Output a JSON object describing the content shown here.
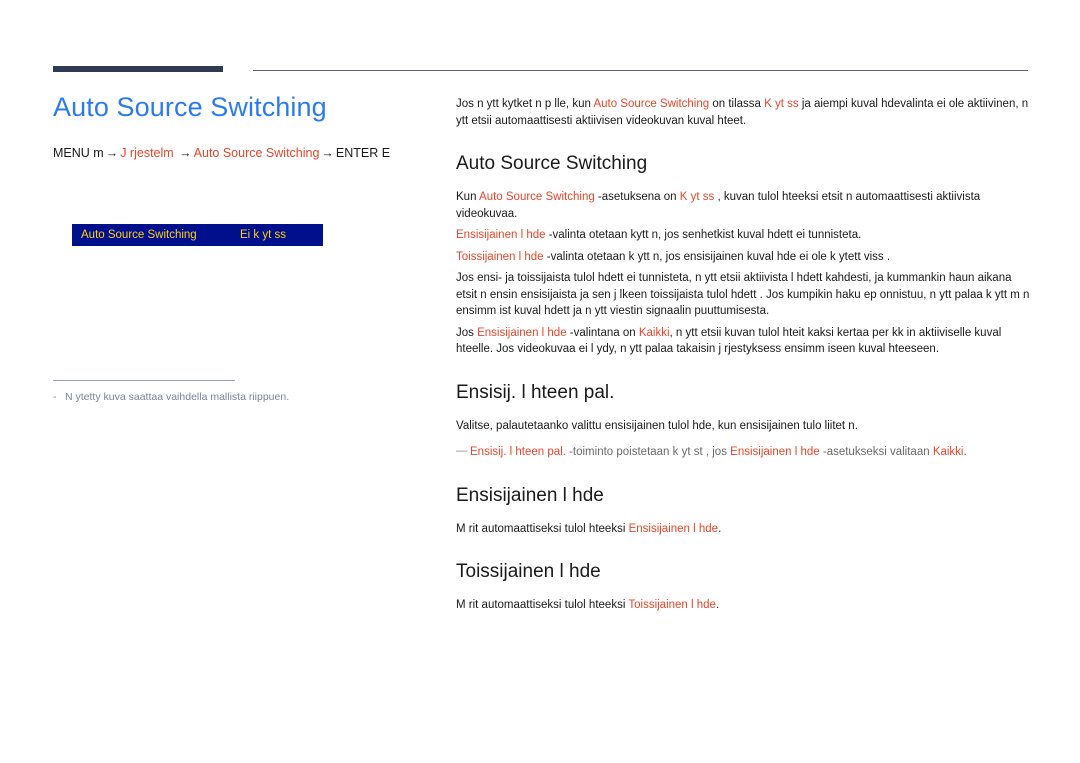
{
  "page": {
    "title": "Auto Source Switching",
    "menu_path": {
      "prefix": "MENU m",
      "arrow": "→",
      "step1": "J rjestelm ",
      "step2": "Auto Source Switching",
      "suffix": "ENTER E"
    }
  },
  "osd": {
    "label": "Auto Source Switching",
    "value": "Ei k yt ss "
  },
  "footnote": {
    "dash": "-",
    "text": "N ytetty kuva saattaa vaihdella mallista riippuen."
  },
  "intro": {
    "t1": "Jos n ytt  kytket  n p  lle, kun ",
    "a1": "Auto Source Switching",
    "t2": " on tilassa ",
    "a2": "K yt ss ",
    "t3": " ja aiempi kuval hdevalinta ei ole aktiivinen, n ytt  etsii automaattisesti aktiivisen videokuvan kuval hteet."
  },
  "sections": [
    {
      "heading": "Auto Source Switching",
      "paragraphs": [
        {
          "runs": [
            {
              "text": "Kun ",
              "style": "plain"
            },
            {
              "text": "Auto Source Switching",
              "style": "accent"
            },
            {
              "text": " -asetuksena on ",
              "style": "plain"
            },
            {
              "text": "K yt ss ",
              "style": "accent"
            },
            {
              "text": ", kuvan tulol hteeksi etsit  n automaattisesti aktiivista videokuvaa.",
              "style": "plain"
            }
          ]
        },
        {
          "runs": [
            {
              "text": "Ensisijainen l hde",
              "style": "accent"
            },
            {
              "text": " -valinta otetaan kytt  n, jos senhetkist  kuval hdett  ei tunnisteta.",
              "style": "plain"
            }
          ]
        },
        {
          "runs": [
            {
              "text": "Toissijainen l hde",
              "style": "accent"
            },
            {
              "text": " -valinta otetaan k ytt  n, jos ensisijainen kuval hde ei ole k ytett viss .",
              "style": "plain"
            }
          ]
        },
        {
          "runs": [
            {
              "text": "Jos ensi- ja toissijaista tulol hdett  ei tunnisteta, n ytt  etsii aktiivista l hdett  kahdesti, ja kummankin haun aikana etsit  n ensin ensisijaista ja sen j lkeen toissijaista tulol hdett . Jos kumpikin haku ep onnistuu, n ytt  palaa k ytt m  n ensimm ist  kuval hdett  ja n ytt  viestin signaalin puuttumisesta.",
              "style": "plain"
            }
          ]
        },
        {
          "runs": [
            {
              "text": "Jos ",
              "style": "plain"
            },
            {
              "text": "Ensisijainen l hde",
              "style": "accent"
            },
            {
              "text": " -valintana on ",
              "style": "plain"
            },
            {
              "text": "Kaikki",
              "style": "accent"
            },
            {
              "text": ", n ytt  etsii kuvan tulol hteit  kaksi kertaa per kk in aktiiviselle kuval hteelle. Jos videokuvaa ei l ydy, n ytt  palaa takaisin j rjestyksess  ensimm iseen kuval hteeseen.",
              "style": "plain"
            }
          ]
        }
      ],
      "note": null
    },
    {
      "heading": "Ensisij. l hteen pal.",
      "paragraphs": [
        {
          "runs": [
            {
              "text": "Valitse, palautetaanko valittu ensisijainen tulol hde, kun ensisijainen tulo liitet  n.",
              "style": "plain"
            }
          ]
        }
      ],
      "note": {
        "mark": "—",
        "runs": [
          {
            "text": "Ensisij. l hteen pal.",
            "style": "accent"
          },
          {
            "text": " -toiminto poistetaan k yt st , jos ",
            "style": "muted"
          },
          {
            "text": "Ensisijainen l hde",
            "style": "accent"
          },
          {
            "text": " -asetukseksi valitaan ",
            "style": "muted"
          },
          {
            "text": "Kaikki",
            "style": "accent"
          },
          {
            "text": ".",
            "style": "muted"
          }
        ]
      }
    },
    {
      "heading": "Ensisijainen l hde",
      "paragraphs": [
        {
          "runs": [
            {
              "text": "M  rit  automaattiseksi tulol hteeksi ",
              "style": "plain"
            },
            {
              "text": "Ensisijainen l hde",
              "style": "accent"
            },
            {
              "text": ".",
              "style": "plain"
            }
          ]
        }
      ],
      "note": null
    },
    {
      "heading": "Toissijainen l hde",
      "paragraphs": [
        {
          "runs": [
            {
              "text": "M  rit  automaattiseksi tulol hteeksi ",
              "style": "plain"
            },
            {
              "text": "Toissijainen l hde",
              "style": "accent"
            },
            {
              "text": ".",
              "style": "plain"
            }
          ]
        }
      ],
      "note": null
    }
  ],
  "colors": {
    "title_blue": "#2b7bf0",
    "accent_red": "#e8452a",
    "rule_navy": "#2e3a54",
    "osd_bg": "#000f8c",
    "osd_text": "#ffd11a",
    "muted_gray": "#7d8399"
  }
}
